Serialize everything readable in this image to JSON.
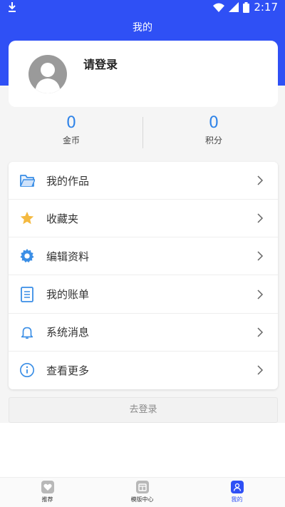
{
  "status_bar": {
    "time": "2:17"
  },
  "page": {
    "title": "我的"
  },
  "profile": {
    "login_prompt": "请登录"
  },
  "stats": [
    {
      "value": "0",
      "label": "金币"
    },
    {
      "value": "0",
      "label": "积分"
    }
  ],
  "menu": [
    {
      "label": "我的作品",
      "icon": "folder-icon"
    },
    {
      "label": "收藏夹",
      "icon": "star-icon"
    },
    {
      "label": "编辑资料",
      "icon": "gear-icon"
    },
    {
      "label": "我的账单",
      "icon": "document-icon"
    },
    {
      "label": "系统消息",
      "icon": "bell-icon"
    },
    {
      "label": "查看更多",
      "icon": "info-icon"
    }
  ],
  "login_button": "去登录",
  "tabs": [
    {
      "label": "推荐",
      "icon": "heart-icon"
    },
    {
      "label": "模版中心",
      "icon": "template-icon"
    },
    {
      "label": "我的",
      "icon": "user-icon"
    }
  ],
  "colors": {
    "primary": "#2f50f5",
    "stat_number": "#2f83e8",
    "star": "#f4b940",
    "icon_blue": "#3a8ee6"
  }
}
